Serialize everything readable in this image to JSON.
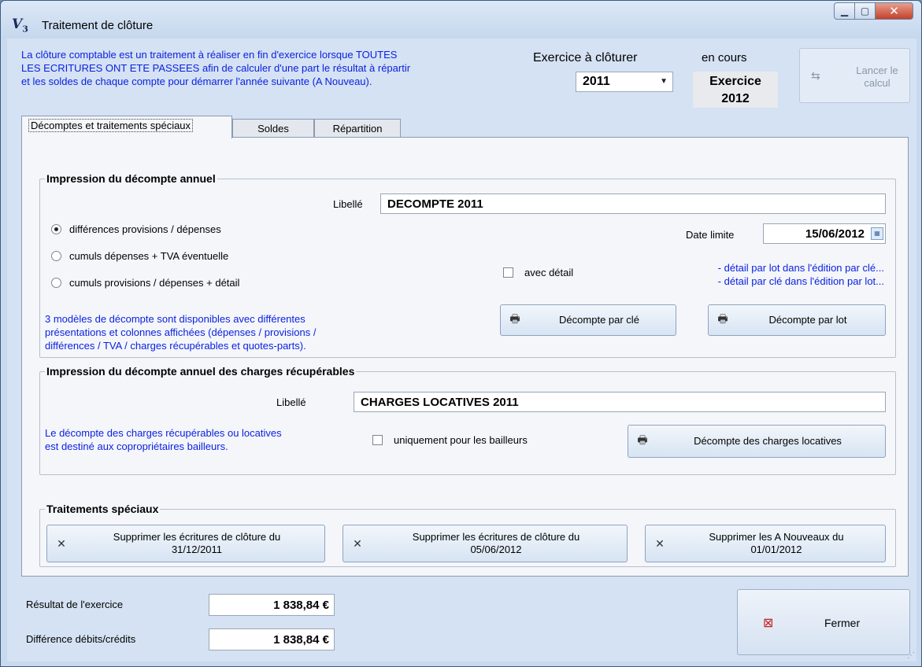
{
  "window": {
    "app_icon": "V",
    "app_icon_sub": "3",
    "title": "Traitement de clôture",
    "controls": {
      "minimize": "minimize-icon",
      "maximize": "maximize-icon",
      "close": "close-icon"
    }
  },
  "header": {
    "info_line1": "La clôture comptable est un traitement à réaliser en fin d'exercice lorsque TOUTES",
    "info_line2": "LES ECRITURES ONT ETE PASSEES afin de calculer d'une part le résultat à répartir",
    "info_line3": "et les soldes de chaque compte pour démarrer l'année suivante (A Nouveau).",
    "exercice_label": "Exercice à clôturer",
    "exercice_value": "2011",
    "encours_label": "en cours",
    "encours_line1": "Exercice",
    "encours_line2": "2012",
    "lancer_line1": "Lancer le",
    "lancer_line2": "calcul"
  },
  "tabs": [
    {
      "label": "Décomptes et traitements spéciaux",
      "active": true
    },
    {
      "label": "Soldes",
      "active": false
    },
    {
      "label": "Répartition",
      "active": false
    }
  ],
  "decompte": {
    "legend": "Impression du décompte annuel",
    "libelle_label": "Libellé",
    "libelle_value": "DECOMPTE 2011",
    "options": [
      {
        "label": "différences provisions / dépenses",
        "selected": true
      },
      {
        "label": "cumuls dépenses + TVA éventuelle",
        "selected": false
      },
      {
        "label": "cumuls provisions / dépenses + détail",
        "selected": false
      }
    ],
    "date_label": "Date limite",
    "date_value": "15/06/2012",
    "avec_detail_label": "avec détail",
    "detail_note1": "- détail par lot dans l'édition par clé...",
    "detail_note2": "- détail par clé dans l'édition par lot...",
    "models_line1": "3 modèles de décompte sont disponibles avec différentes",
    "models_line2": "présentations et colonnes affichées (dépenses / provisions /",
    "models_line3": "différences / TVA / charges récupérables et quotes-parts).",
    "btn_par_cle": "Décompte par clé",
    "btn_par_lot": "Décompte par lot"
  },
  "charges": {
    "legend": "Impression du décompte annuel des charges récupérables",
    "libelle_label": "Libellé",
    "libelle_value": "CHARGES LOCATIVES 2011",
    "note_line1": "Le décompte des charges récupérables ou locatives",
    "note_line2": "est destiné aux copropriétaires bailleurs.",
    "bailleurs_label": "uniquement pour les bailleurs",
    "btn_label": "Décompte des charges locatives"
  },
  "speciaux": {
    "legend": "Traitements spéciaux",
    "btn1_line1": "Supprimer les écritures de clôture du",
    "btn1_line2": "31/12/2011",
    "btn2_line1": "Supprimer les écritures de clôture du",
    "btn2_line2": "05/06/2012",
    "btn3_line1": "Supprimer les A Nouveaux du",
    "btn3_line2": "01/01/2012"
  },
  "footer": {
    "resultat_label": "Résultat de l'exercice",
    "resultat_value": "1 838,84 €",
    "difference_label": "Différence débits/crédits",
    "difference_value": "1 838,84 €",
    "fermer_label": "Fermer"
  },
  "colors": {
    "info_blue": "#0a1fe0",
    "delete_red": "#d01010"
  }
}
